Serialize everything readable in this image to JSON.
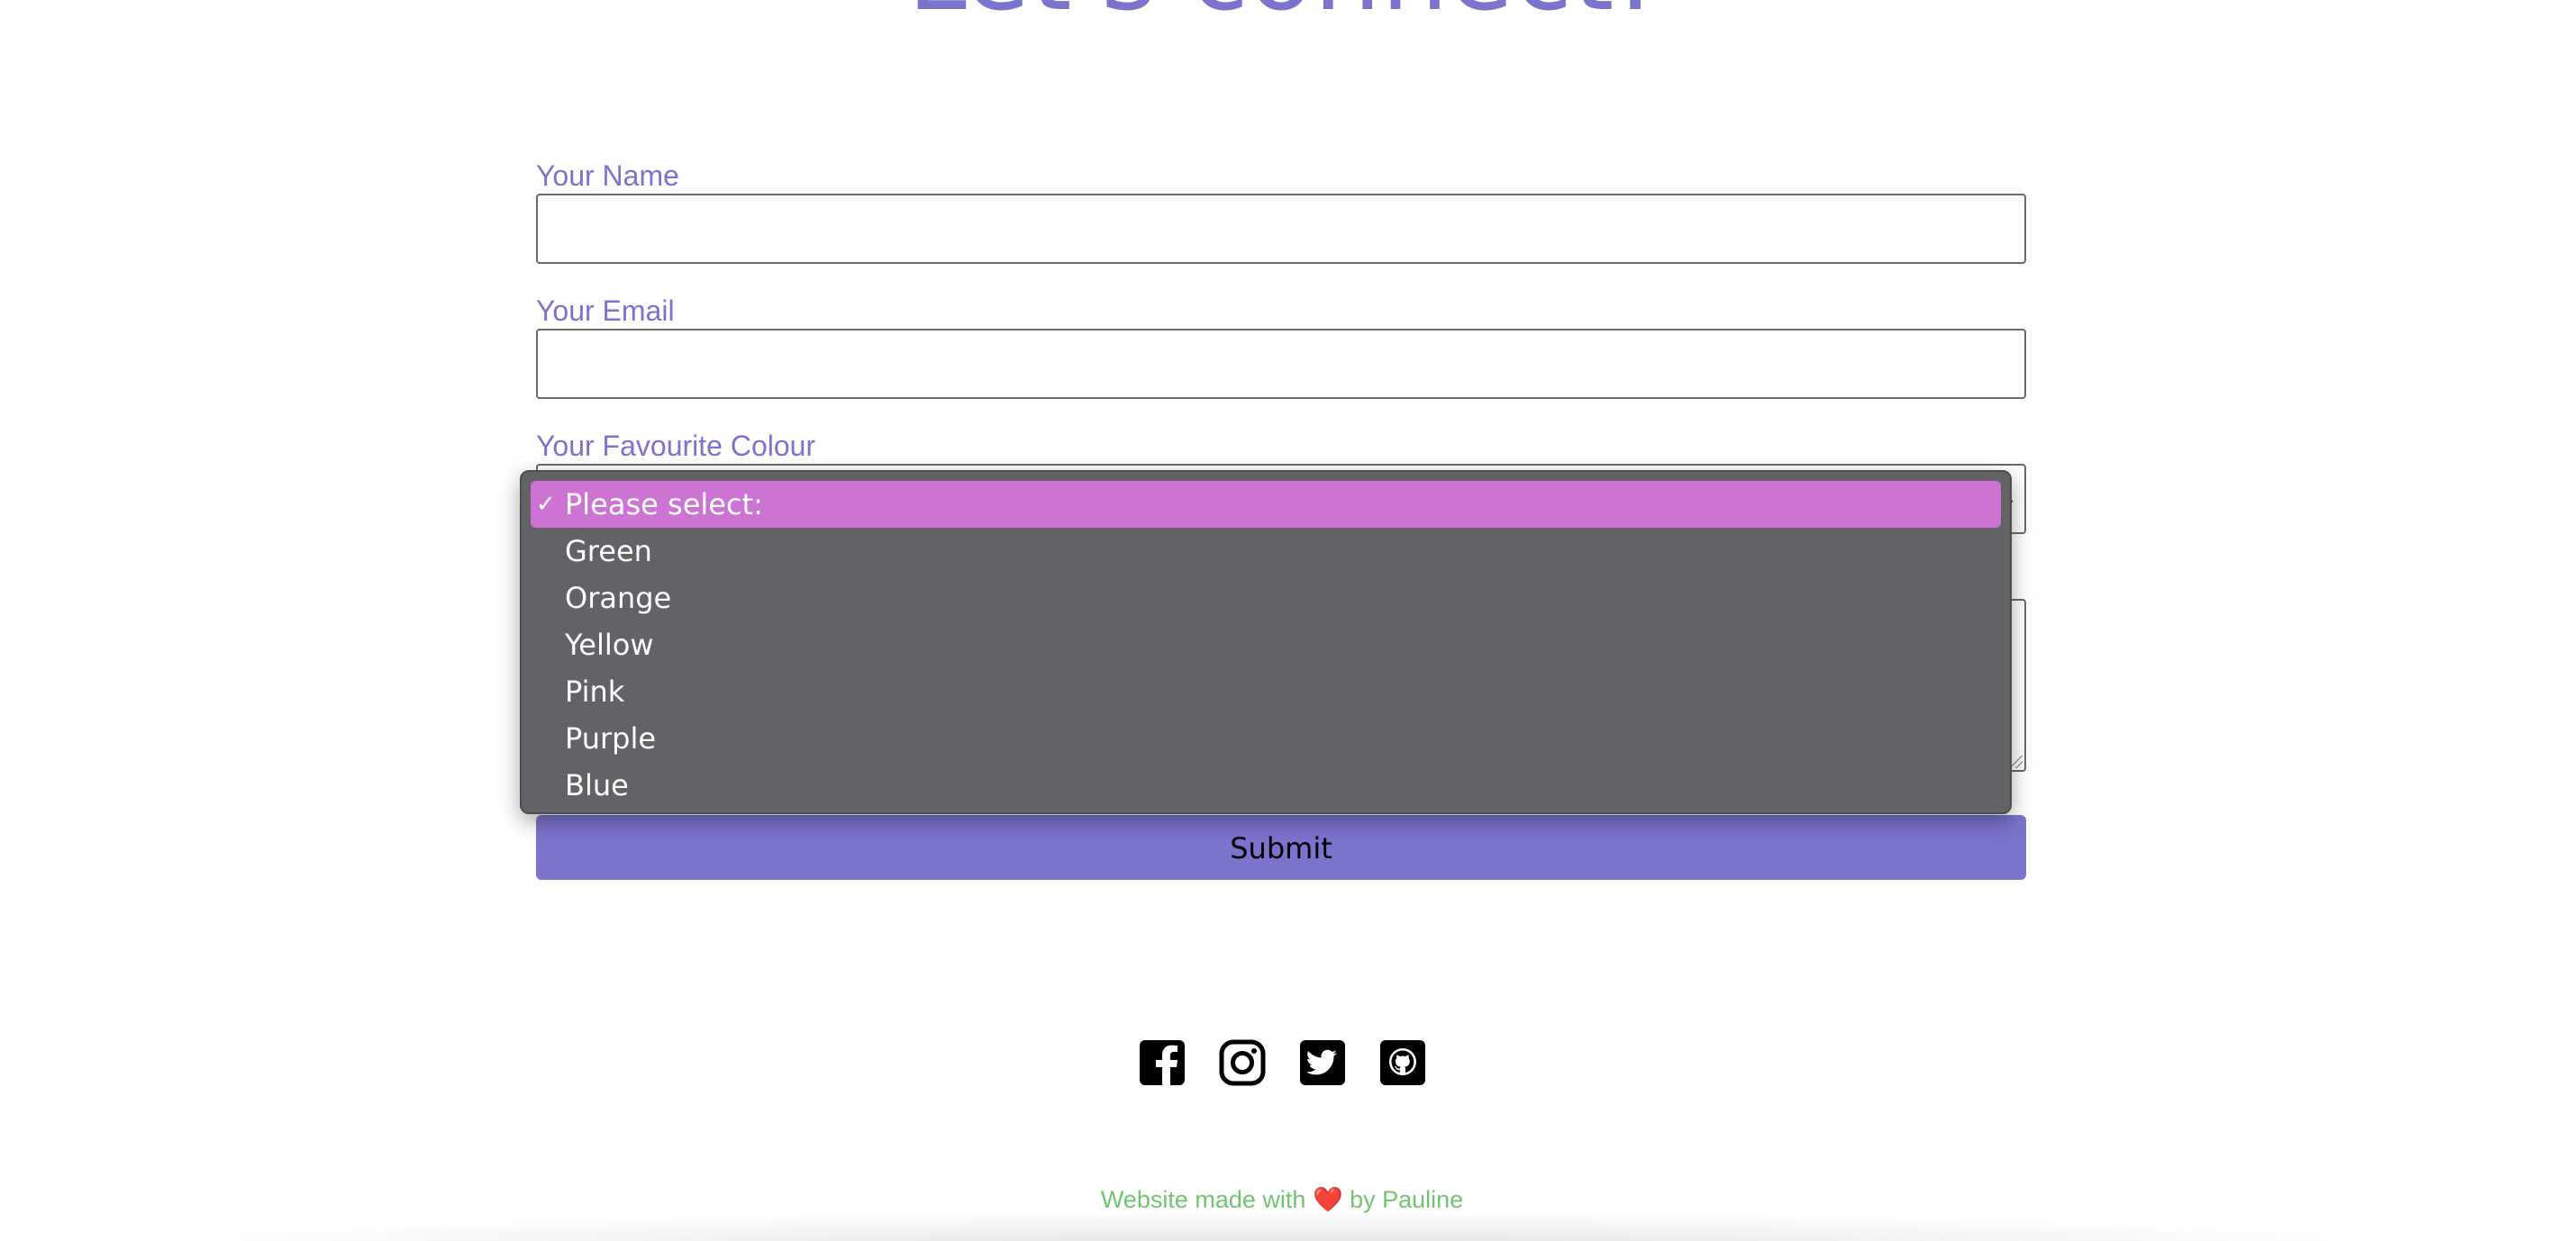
{
  "page": {
    "heading": "Let's connect!"
  },
  "form": {
    "name_label": "Your Name",
    "name_value": "",
    "email_label": "Your Email",
    "email_value": "",
    "colour_label": "Your Favourite Colour",
    "colour_selected": "Please select:",
    "colour_options": [
      "Please select:",
      "Green",
      "Orange",
      "Yellow",
      "Pink",
      "Purple",
      "Blue"
    ],
    "message_value": "",
    "submit_label": "Submit"
  },
  "socials": {
    "icons": [
      "facebook-icon",
      "instagram-icon",
      "twitter-icon",
      "github-icon"
    ]
  },
  "footer": {
    "text_before": "Website made with",
    "heart": "❤️",
    "text_after": "by Pauline"
  },
  "colors": {
    "accent": "#7b74cd",
    "option_highlight": "#cc73d3",
    "dropdown_bg": "#636367",
    "footer_text": "#72c472"
  }
}
